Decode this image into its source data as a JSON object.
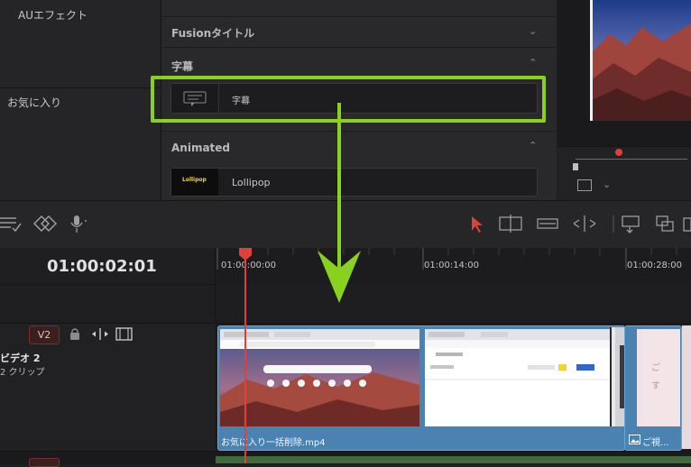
{
  "left_panel": {
    "items": [
      {
        "label": "AUエフェクト"
      },
      {
        "label": "お気に入り"
      }
    ]
  },
  "effects": {
    "sections": [
      {
        "title": "Fusionタイトル",
        "chevron": "chevron-down-icon"
      },
      {
        "title": "字幕",
        "chevron": "chevron-up-icon",
        "items": [
          {
            "label": "字幕",
            "thumb_icon": "subtitle-icon"
          }
        ]
      },
      {
        "title": "Animated",
        "chevron": "chevron-up-icon",
        "items": [
          {
            "label": "Lollipop",
            "thumb_text": "Lollipop"
          }
        ]
      }
    ],
    "highlight_color": "#8ad11f"
  },
  "timeline": {
    "timecode": "01:00:02:01",
    "ruler": [
      "01:00:00:00",
      "01:00:14:00",
      "01:00:28:00"
    ],
    "track": {
      "badge": "V2",
      "name": "ビデオ 2",
      "clips_count": "2 クリップ"
    },
    "clips": [
      {
        "label": "お気に入り一括削除.mp4"
      },
      {
        "label": "ご視..."
      }
    ],
    "playhead_color": "#e0403a"
  },
  "colors": {
    "accent_green": "#8ad11f",
    "clip_blue": "#4a82b2",
    "track_red": "#7a2d2d"
  }
}
